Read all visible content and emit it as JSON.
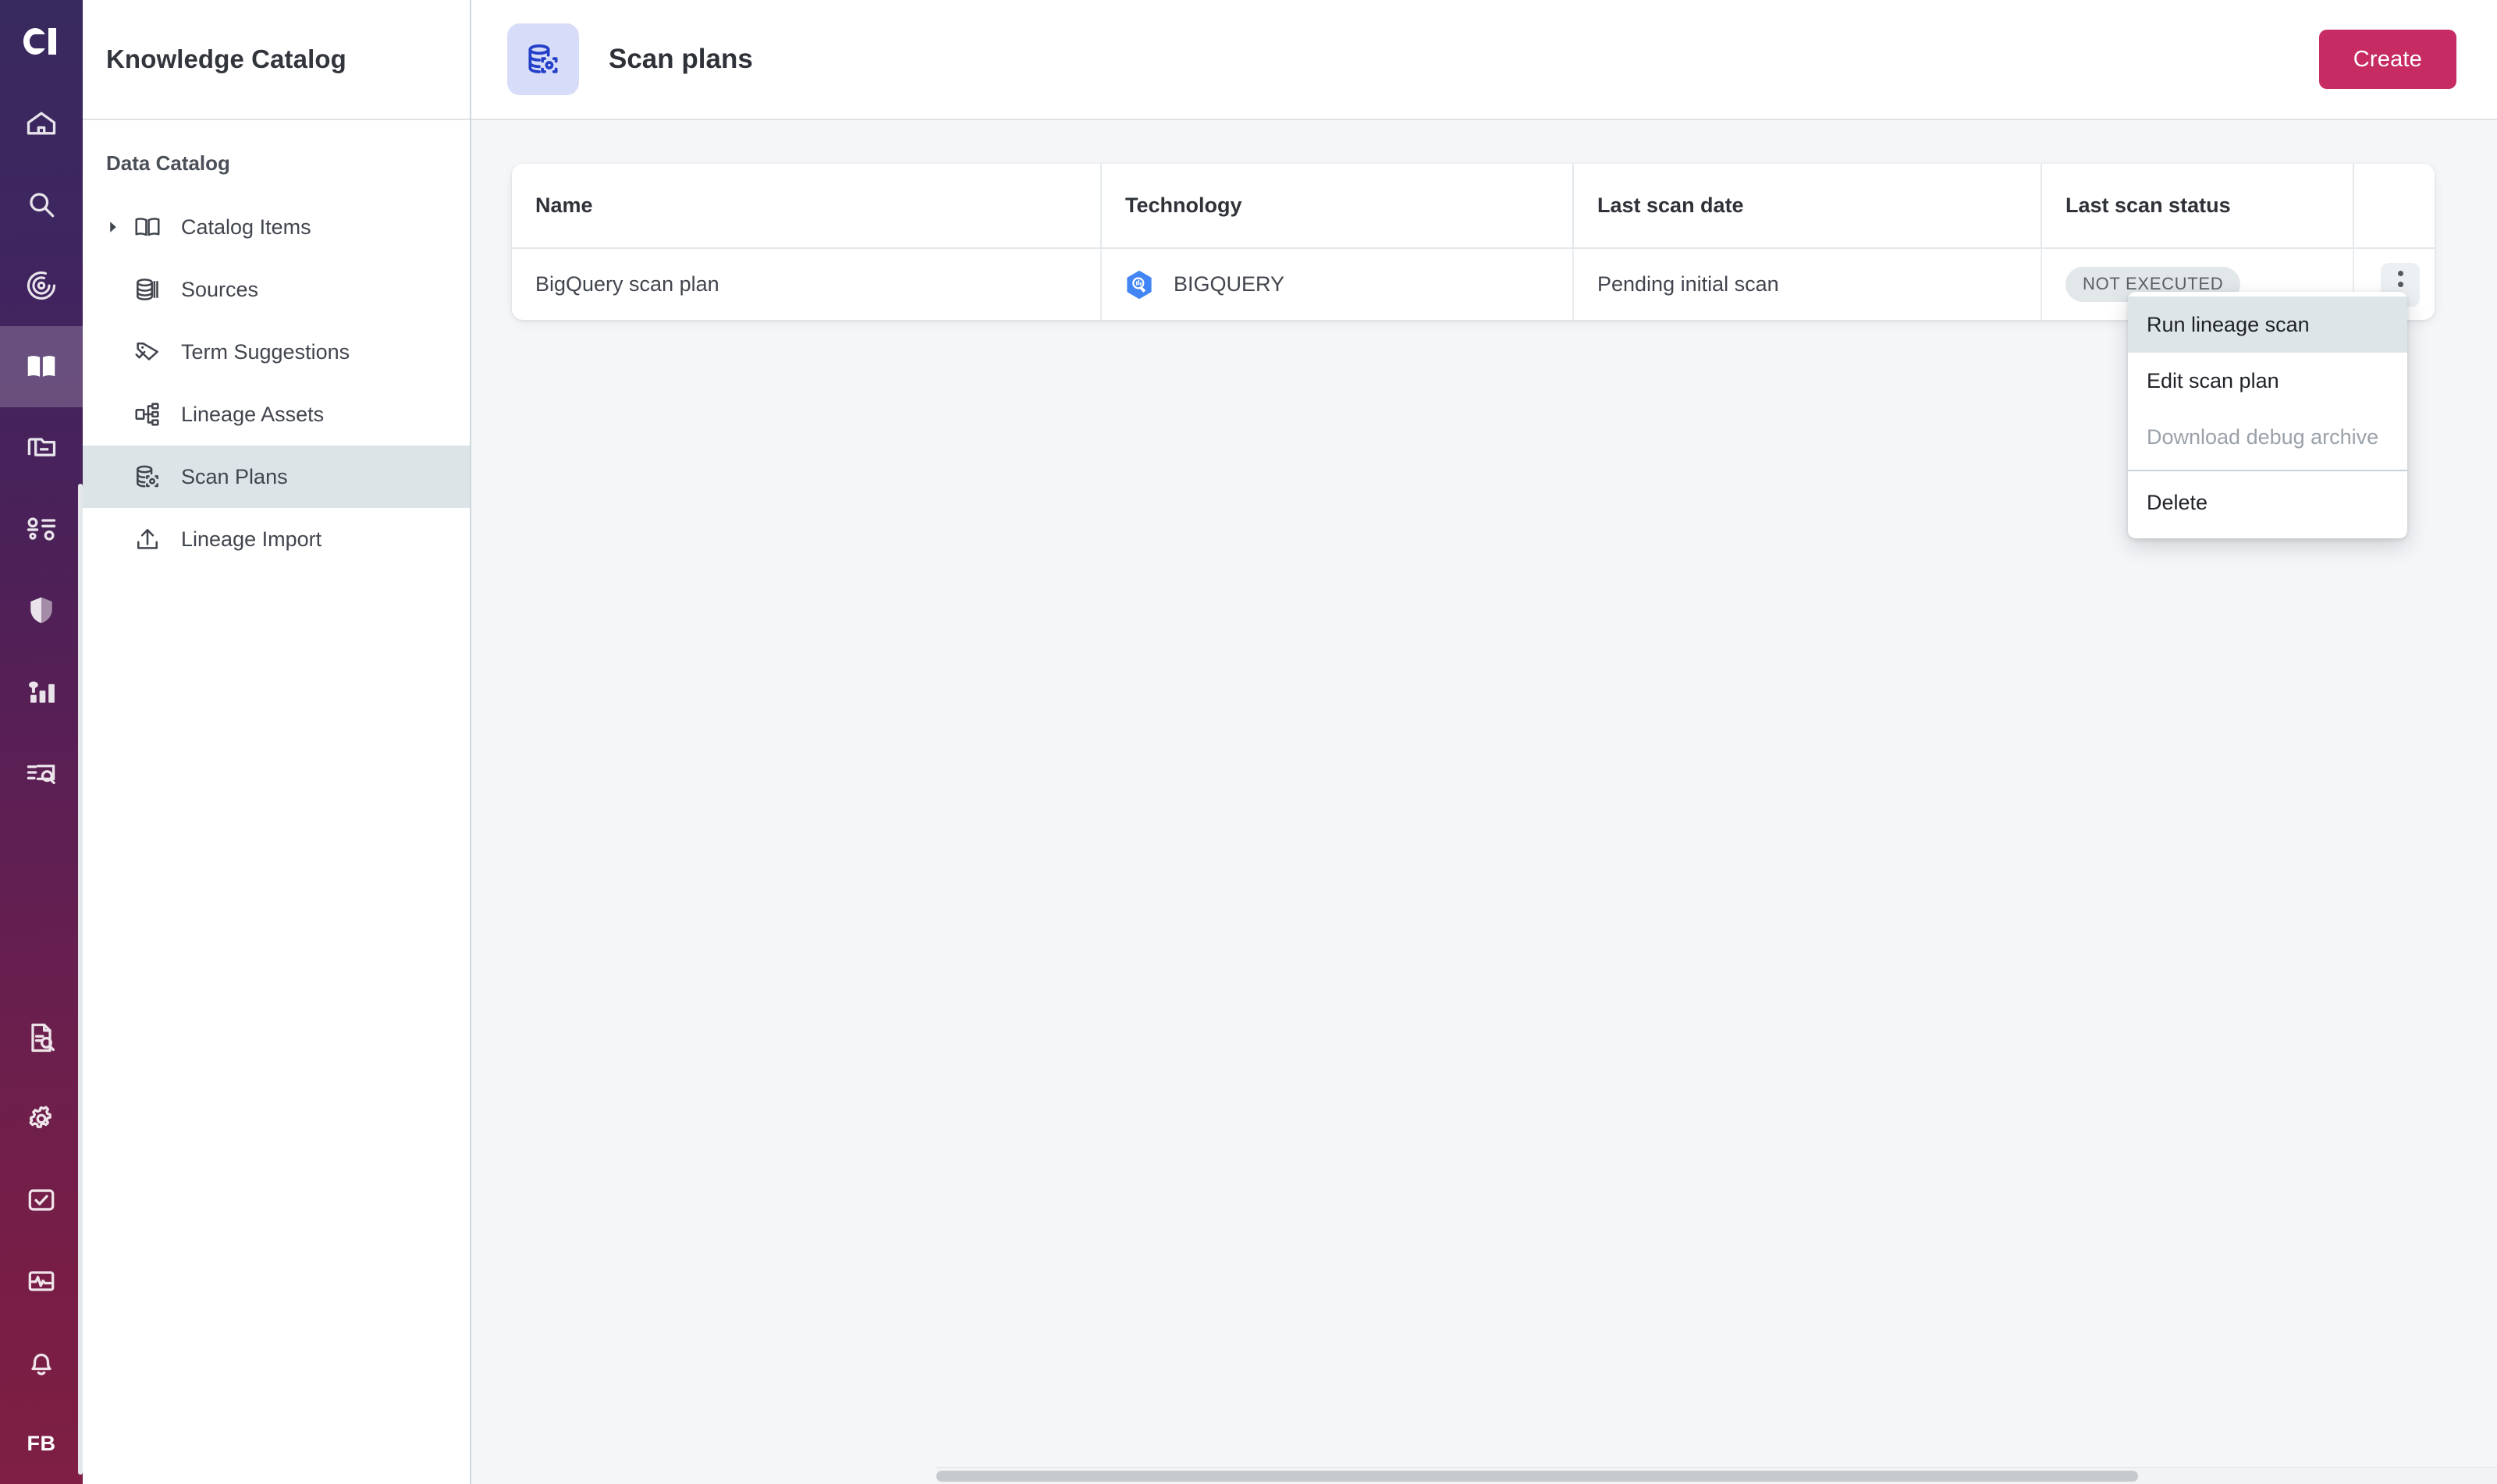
{
  "brand": {
    "logo_alt": "app-logo",
    "gradient_top": "#382A5E",
    "gradient_bottom": "#7E1F43",
    "accent_pink": "#C62B63",
    "accent_indigo": "#2540C8"
  },
  "rail": {
    "items": [
      {
        "icon": "home-icon",
        "active": false
      },
      {
        "icon": "search-icon",
        "active": false
      },
      {
        "icon": "target-icon",
        "active": false
      },
      {
        "icon": "book-icon",
        "active": true
      },
      {
        "icon": "folder-stack-icon",
        "active": false
      },
      {
        "icon": "workflow-icon",
        "active": false
      },
      {
        "icon": "shield-icon",
        "active": false
      },
      {
        "icon": "bar-chart-icon",
        "active": false
      },
      {
        "icon": "query-document-icon",
        "active": false
      }
    ],
    "bottom_items": [
      {
        "icon": "document-search-icon"
      },
      {
        "icon": "gear-icon"
      },
      {
        "icon": "checkbox-icon"
      },
      {
        "icon": "monitor-pulse-icon"
      },
      {
        "icon": "bell-icon"
      }
    ],
    "avatar_initials": "FB"
  },
  "sidebar": {
    "title": "Knowledge Catalog",
    "section_label": "Data Catalog",
    "items": [
      {
        "label": "Catalog Items",
        "icon": "book-open-icon",
        "caret": true,
        "selected": false
      },
      {
        "label": "Sources",
        "icon": "database-icon",
        "caret": false,
        "selected": false
      },
      {
        "label": "Term Suggestions",
        "icon": "tag-check-icon",
        "caret": false,
        "selected": false
      },
      {
        "label": "Lineage Assets",
        "icon": "lineage-icon",
        "caret": false,
        "selected": false
      },
      {
        "label": "Scan Plans",
        "icon": "scan-plan-icon",
        "caret": false,
        "selected": true
      },
      {
        "label": "Lineage Import",
        "icon": "upload-icon",
        "caret": false,
        "selected": false
      }
    ]
  },
  "topbar": {
    "page_icon": "scan-plan-icon",
    "title": "Scan plans",
    "create_label": "Create"
  },
  "table": {
    "columns": [
      "Name",
      "Technology",
      "Last scan date",
      "Last scan status",
      ""
    ],
    "rows": [
      {
        "name": "BigQuery scan plan",
        "technology": "BIGQUERY",
        "technology_icon": "bigquery-icon",
        "last_scan_date": "Pending initial scan",
        "last_scan_status": "NOT EXECUTED"
      }
    ]
  },
  "context_menu": {
    "items": [
      {
        "label": "Run lineage scan",
        "state": "highlight"
      },
      {
        "label": "Edit scan plan",
        "state": "normal"
      },
      {
        "label": "Download debug archive",
        "state": "disabled"
      },
      {
        "label": "Delete",
        "state": "normal",
        "separator_before": true
      }
    ]
  }
}
